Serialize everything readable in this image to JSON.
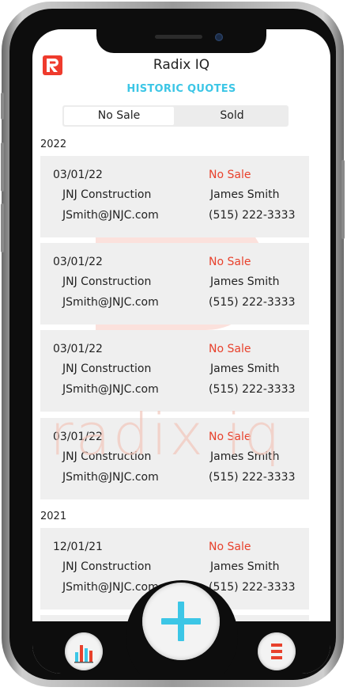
{
  "app": {
    "title": "Radix IQ",
    "subtitle": "HISTORIC QUOTES",
    "watermark": "radix iq",
    "accent": "#3cc6e6",
    "brand": "#ef3b2d"
  },
  "segment": {
    "options": [
      "No Sale",
      "Sold"
    ],
    "selected": "No Sale"
  },
  "sections": [
    {
      "year": "2022",
      "quotes": [
        {
          "date": "03/01/22",
          "status": "No Sale",
          "company": "JNJ Construction",
          "contact": "James Smith",
          "email": "JSmith@JNJC.com",
          "phone": "(515) 222-3333"
        },
        {
          "date": "03/01/22",
          "status": "No Sale",
          "company": "JNJ Construction",
          "contact": "James Smith",
          "email": "JSmith@JNJC.com",
          "phone": "(515) 222-3333"
        },
        {
          "date": "03/01/22",
          "status": "No Sale",
          "company": "JNJ Construction",
          "contact": "James Smith",
          "email": "JSmith@JNJC.com",
          "phone": "(515) 222-3333"
        },
        {
          "date": "03/01/22",
          "status": "No Sale",
          "company": "JNJ Construction",
          "contact": "James Smith",
          "email": "JSmith@JNJC.com",
          "phone": "(515) 222-3333"
        }
      ]
    },
    {
      "year": "2021",
      "quotes": [
        {
          "date": "12/01/21",
          "status": "No Sale",
          "company": "JNJ Construction",
          "contact": "James Smith",
          "email": "JSmith@JNJC.com",
          "phone": "(515) 222-3333"
        }
      ]
    }
  ],
  "bottom_bar": {
    "left_icon": "bar-chart-icon",
    "center_icon": "plus-icon",
    "right_icon": "menu-icon"
  }
}
